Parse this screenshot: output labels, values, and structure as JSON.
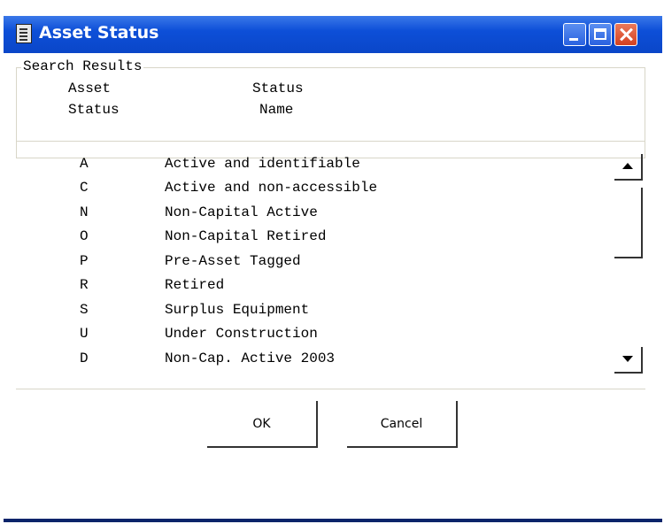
{
  "window": {
    "title": "Asset Status"
  },
  "search_results": {
    "legend": "Search Results",
    "columns": [
      {
        "line1": "Asset",
        "line2": "Status"
      },
      {
        "line1": "Status",
        "line2": "Name"
      }
    ],
    "rows": [
      {
        "code": "A",
        "name": "Active and identifiable"
      },
      {
        "code": "C",
        "name": "Active and non-accessible"
      },
      {
        "code": "N",
        "name": "Non-Capital Active"
      },
      {
        "code": "O",
        "name": "Non-Capital Retired"
      },
      {
        "code": "P",
        "name": "Pre-Asset Tagged"
      },
      {
        "code": "R",
        "name": "Retired"
      },
      {
        "code": "S",
        "name": "Surplus Equipment"
      },
      {
        "code": "U",
        "name": "Under Construction"
      },
      {
        "code": "D",
        "name": "Non-Cap. Active 2003"
      }
    ]
  },
  "buttons": {
    "ok": "OK",
    "cancel": "Cancel"
  },
  "colors": {
    "titlebar": "#0d4fd8",
    "frame": "#0a246a",
    "close": "#d44020"
  }
}
